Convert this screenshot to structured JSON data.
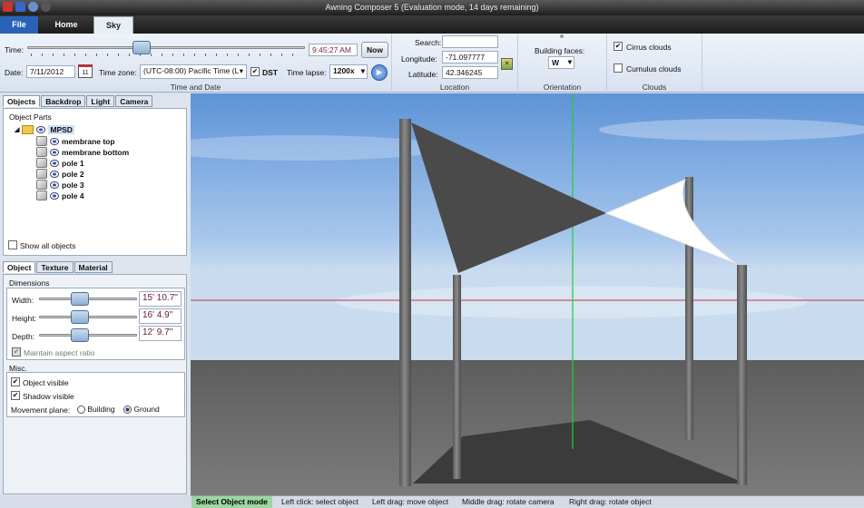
{
  "window": {
    "title": "Awning Composer 5 (Evaluation mode, 14 days remaining)"
  },
  "ribbon_tabs": {
    "file": "File",
    "home": "Home",
    "sky": "Sky"
  },
  "time_date": {
    "time_label": "Time:",
    "time_value": "9:45:27 AM",
    "now_button": "Now",
    "date_label": "Date:",
    "date_value": "7/11/2012",
    "calendar_day": "11",
    "timezone_label": "Time zone:",
    "timezone_value": "(UTC-08:00) Pacific Time (L",
    "dst_label": "DST",
    "dst_checked": true,
    "timelapse_label": "Time lapse:",
    "timelapse_value": "1200x",
    "group_label": "Time and Date"
  },
  "location": {
    "search_label": "Search:",
    "search_value": "",
    "longitude_label": "Longitude:",
    "longitude_value": "-71.097777",
    "latitude_label": "Latitude:",
    "latitude_value": "42.346245",
    "group_label": "Location"
  },
  "orientation": {
    "building_faces_label": "Building faces:",
    "building_faces_value": "W",
    "group_label": "Orientation"
  },
  "clouds": {
    "cirrus_label": "Cirrus clouds",
    "cirrus_checked": true,
    "cumulus_label": "Cumulus clouds",
    "cumulus_checked": false,
    "group_label": "Clouds"
  },
  "object_panel": {
    "tabs": [
      "Objects",
      "Backdrop",
      "Light",
      "Camera"
    ],
    "parts_label": "Object Parts",
    "root": "MPSD",
    "items": [
      "membrane top",
      "membrane bottom",
      "pole 1",
      "pole 2",
      "pole 3",
      "pole 4"
    ],
    "show_all_label": "Show all objects"
  },
  "props_panel": {
    "tabs": [
      "Object",
      "Texture",
      "Material"
    ],
    "dimensions_label": "Dimensions",
    "width_label": "Width:",
    "width_value": "15' 10.7\"",
    "height_label": "Height:",
    "height_value": "16' 4.9\"",
    "depth_label": "Depth:",
    "depth_value": "12' 9.7\"",
    "maintain_label": "Maintain aspect ratio",
    "misc_label": "Misc.",
    "object_visible_label": "Object visible",
    "shadow_visible_label": "Shadow visible",
    "movement_label": "Movement plane:",
    "building_label": "Building",
    "ground_label": "Ground",
    "movement_value": "Ground"
  },
  "status": {
    "mode": "Select Object mode",
    "hints": [
      "Left click: select object",
      "Left drag: move object",
      "Middle drag: rotate camera",
      "Right drag: rotate object"
    ]
  },
  "colors": {
    "membrane_top": "#4a4a4a",
    "membrane_bottom": "#ffffff",
    "pole": "#6e6e6e",
    "ground": "#6b6b6b",
    "sky": "#6fa3e0",
    "accent": "#2a62b8",
    "status_mode": "#9bd7a0"
  }
}
